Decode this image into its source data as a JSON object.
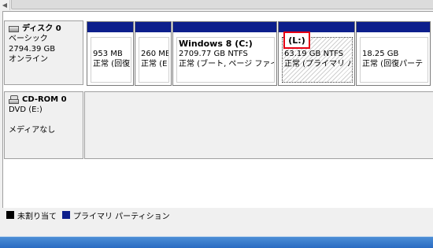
{
  "disk0": {
    "title": "ディスク 0",
    "type": "ベーシック",
    "size": "2794.39 GB",
    "status": "オンライン"
  },
  "partitions": [
    {
      "name": "",
      "size": "953 MB",
      "status": "正常 (回復"
    },
    {
      "name": "",
      "size": "260 MB",
      "status": "正常 (E"
    },
    {
      "name": "Windows 8  (C:)",
      "size": "2709.77 GB NTFS",
      "status": "正常 (ブート, ページ ファイル"
    },
    {
      "name": "(L:)",
      "size": "63.19 GB NTFS",
      "status": "正常 (プライマリ パー"
    },
    {
      "name": "",
      "size": "18.25 GB",
      "status": "正常 (回復パーテ"
    }
  ],
  "cdrom": {
    "title": "CD-ROM 0",
    "type": "DVD (E:)",
    "media": "メディアなし"
  },
  "legend": {
    "unallocated": "未割り当て",
    "primary": "プライマリ パーティション"
  },
  "colors": {
    "primary_bar": "#0d1f8c",
    "unallocated": "#000000",
    "highlight": "#e60012"
  },
  "icons": [
    "disk-icon",
    "cdrom-icon",
    "scroll-left-icon"
  ]
}
